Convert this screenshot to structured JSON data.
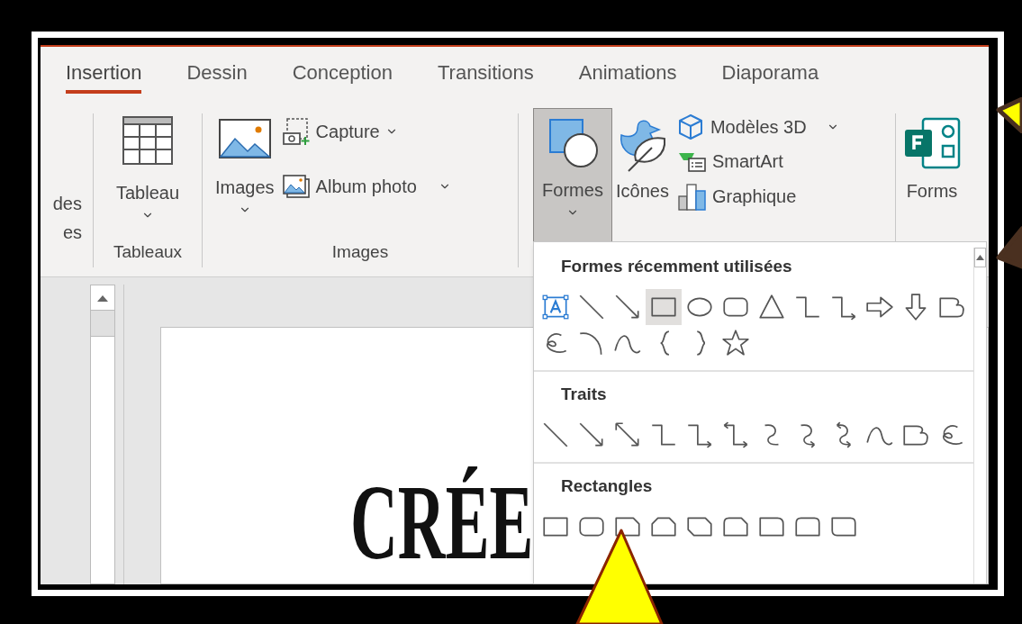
{
  "tabs": [
    {
      "label": "Insertion",
      "selected": true
    },
    {
      "label": "Dessin",
      "selected": false
    },
    {
      "label": "Conception",
      "selected": false
    },
    {
      "label": "Transitions",
      "selected": false
    },
    {
      "label": "Animations",
      "selected": false
    },
    {
      "label": "Diaporama",
      "selected": false
    }
  ],
  "ribbon": {
    "cut_labels": [
      "des",
      "es"
    ],
    "table_group": {
      "label": "Tableaux",
      "button": "Tableau"
    },
    "images_group": {
      "label": "Images",
      "images": "Images",
      "capture": "Capture",
      "album": "Album photo"
    },
    "illustrations": {
      "shapes": {
        "label": "Formes",
        "selected": true
      },
      "icons": "Icônes",
      "models": "Modèles 3D",
      "smartart": "SmartArt",
      "chart": "Graphique"
    },
    "forms": "Forms"
  },
  "shapes_gallery": {
    "sections": [
      {
        "title": "Formes récemment utilisées",
        "shapes": [
          {
            "kind": "textbox",
            "selected": false
          },
          {
            "kind": "line",
            "selected": false
          },
          {
            "kind": "arrow",
            "selected": false
          },
          {
            "kind": "rect",
            "selected": true
          },
          {
            "kind": "ellipse",
            "selected": false
          },
          {
            "kind": "rounded-rect",
            "selected": false
          },
          {
            "kind": "triangle",
            "selected": false
          },
          {
            "kind": "elbow",
            "selected": false
          },
          {
            "kind": "elbow-arrow",
            "selected": false
          },
          {
            "kind": "block-arrow-right",
            "selected": false
          },
          {
            "kind": "block-arrow-down",
            "selected": false
          },
          {
            "kind": "freeform",
            "selected": false
          },
          {
            "kind": "scribble",
            "selected": false
          },
          {
            "kind": "arc",
            "selected": false
          },
          {
            "kind": "curve",
            "selected": false
          },
          {
            "kind": "brace-left",
            "selected": false
          },
          {
            "kind": "brace-right",
            "selected": false
          },
          {
            "kind": "star",
            "selected": false
          }
        ]
      },
      {
        "title": "Traits",
        "shapes": [
          {
            "kind": "line",
            "selected": false
          },
          {
            "kind": "arrow",
            "selected": false
          },
          {
            "kind": "double-arrow",
            "selected": false
          },
          {
            "kind": "elbow",
            "selected": false
          },
          {
            "kind": "elbow-arrow",
            "selected": false
          },
          {
            "kind": "elbow-double-arrow",
            "selected": false
          },
          {
            "kind": "curved-connector",
            "selected": false
          },
          {
            "kind": "curved-arrow",
            "selected": false
          },
          {
            "kind": "curved-double-arrow",
            "selected": false
          },
          {
            "kind": "curve",
            "selected": false
          },
          {
            "kind": "freeform",
            "selected": false
          },
          {
            "kind": "scribble",
            "selected": false
          }
        ]
      },
      {
        "title": "Rectangles",
        "shapes": [
          {
            "kind": "rect",
            "selected": false
          },
          {
            "kind": "rounded-rect",
            "selected": false
          },
          {
            "kind": "snip-one",
            "selected": false
          },
          {
            "kind": "snip-same",
            "selected": false
          },
          {
            "kind": "snip-diag",
            "selected": false
          },
          {
            "kind": "snip-round",
            "selected": false
          },
          {
            "kind": "round-one",
            "selected": false
          },
          {
            "kind": "round-same",
            "selected": false
          },
          {
            "kind": "round-diag",
            "selected": false
          }
        ]
      }
    ]
  },
  "slide": {
    "title": "CRÉE"
  }
}
